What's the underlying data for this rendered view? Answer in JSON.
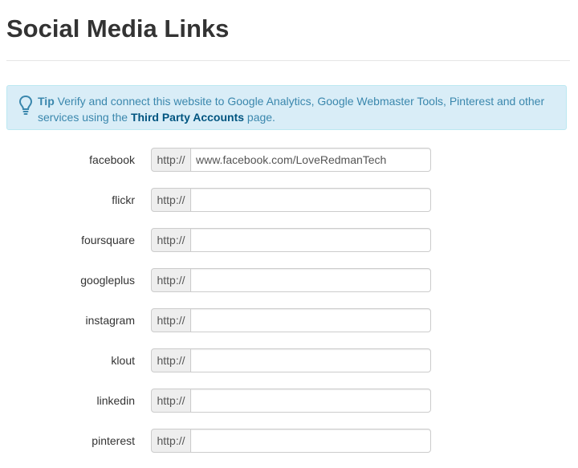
{
  "page": {
    "title": "Social Media Links"
  },
  "tip": {
    "label": "Tip",
    "text_before": "Verify and connect this website to Google Analytics, Google Webmaster Tools, Pinterest and other services using the",
    "link_text": "Third Party Accounts",
    "text_after": "page.",
    "icon": "lightbulb-icon"
  },
  "fields": [
    {
      "label": "facebook",
      "prefix": "http://",
      "value": "www.facebook.com/LoveRedmanTech"
    },
    {
      "label": "flickr",
      "prefix": "http://",
      "value": ""
    },
    {
      "label": "foursquare",
      "prefix": "http://",
      "value": ""
    },
    {
      "label": "googleplus",
      "prefix": "http://",
      "value": ""
    },
    {
      "label": "instagram",
      "prefix": "http://",
      "value": ""
    },
    {
      "label": "klout",
      "prefix": "http://",
      "value": ""
    },
    {
      "label": "linkedin",
      "prefix": "http://",
      "value": ""
    },
    {
      "label": "pinterest",
      "prefix": "http://",
      "value": ""
    }
  ],
  "colors": {
    "tip_background": "#d9edf7",
    "tip_text": "#3a87ad",
    "tip_link": "#005580",
    "addon_background": "#eeeeee"
  }
}
